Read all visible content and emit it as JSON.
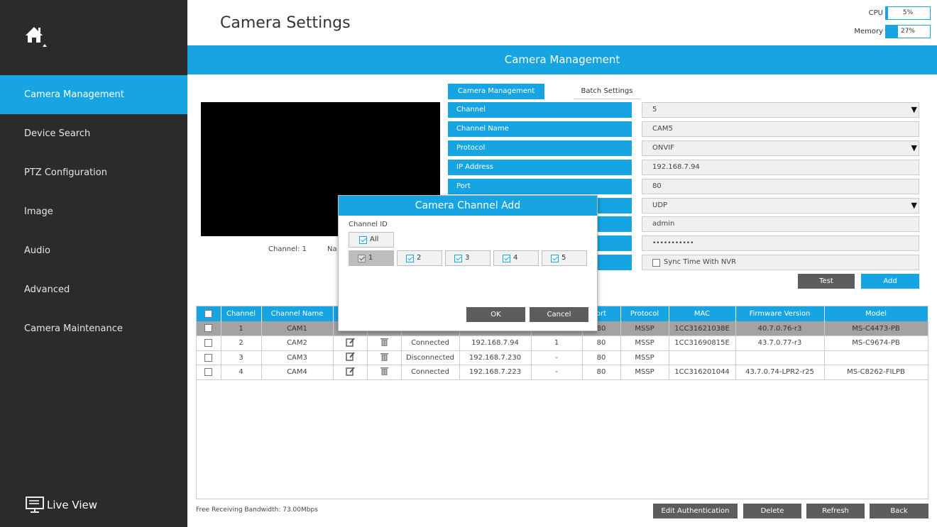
{
  "sidebar": {
    "home_icon": "home-icon",
    "items": [
      {
        "label": "Camera Management",
        "active": true
      },
      {
        "label": "Device Search",
        "active": false
      },
      {
        "label": "PTZ Configuration",
        "active": false
      },
      {
        "label": "Image",
        "active": false
      },
      {
        "label": "Audio",
        "active": false
      },
      {
        "label": "Advanced",
        "active": false
      },
      {
        "label": "Camera Maintenance",
        "active": false
      }
    ],
    "live_view_label": "Live View"
  },
  "header": {
    "title": "Camera Settings",
    "cpu_label": "CPU",
    "cpu_value": "5%",
    "cpu_fill": 0.05,
    "memory_label": "Memory",
    "memory_value": "27%",
    "memory_fill": 0.27
  },
  "banner": {
    "title": "Camera Management"
  },
  "preview": {
    "channel_text": "Channel: 1",
    "name_text": "Na"
  },
  "tabs": {
    "active": "Camera Management",
    "other": "Batch Settings"
  },
  "form": {
    "channel_label": "Channel",
    "channel_value": "5",
    "channel_name_label": "Channel Name",
    "channel_name_value": "CAM5",
    "protocol_label": "Protocol",
    "protocol_value": "ONVIF",
    "ip_label": "IP Address",
    "ip_value": "192.168.7.94",
    "port_label": "Port",
    "port_value": "80",
    "transfer_value": "UDP",
    "user_value": "admin",
    "password_value": "•••••••••••",
    "sync_label": "Sync Time With NVR",
    "test_button": "Test",
    "add_button": "Add"
  },
  "table": {
    "headers": [
      "",
      "Channel",
      "Channel Name",
      "",
      "",
      "",
      "",
      "",
      "ort",
      "Protocol",
      "MAC",
      "Firmware Version",
      "Model"
    ],
    "rows": [
      {
        "channel": "1",
        "name": "CAM1",
        "status": "",
        "ip": "",
        "misc": "",
        "port": "80",
        "protocol": "MSSP",
        "mac": "1CC31621038E",
        "firmware": "40.7.0.76-r3",
        "model": "MS-C4473-PB"
      },
      {
        "channel": "2",
        "name": "CAM2",
        "status": "Connected",
        "ip": "192.168.7.94",
        "misc": "1",
        "port": "80",
        "protocol": "MSSP",
        "mac": "1CC31690815E",
        "firmware": "43.7.0.77-r3",
        "model": "MS-C9674-PB"
      },
      {
        "channel": "3",
        "name": "CAM3",
        "status": "Disconnected",
        "ip": "192.168.7.230",
        "misc": "-",
        "port": "80",
        "protocol": "MSSP",
        "mac": "",
        "firmware": "",
        "model": ""
      },
      {
        "channel": "4",
        "name": "CAM4",
        "status": "Connected",
        "ip": "192.168.7.223",
        "misc": "-",
        "port": "80",
        "protocol": "MSSP",
        "mac": "1CC316201044",
        "firmware": "43.7.0.74-LPR2-r25",
        "model": "MS-C8262-FILPB"
      }
    ]
  },
  "footer": {
    "bandwidth": "Free Receiving Bandwidth: 73.00Mbps",
    "edit_auth": "Edit Authentication",
    "delete": "Delete",
    "refresh": "Refresh",
    "back": "Back"
  },
  "dialog": {
    "title": "Camera Channel Add",
    "channel_id_label": "Channel ID",
    "all_label": "All",
    "channels": [
      "1",
      "2",
      "3",
      "4",
      "5"
    ],
    "ok": "OK",
    "cancel": "Cancel"
  }
}
